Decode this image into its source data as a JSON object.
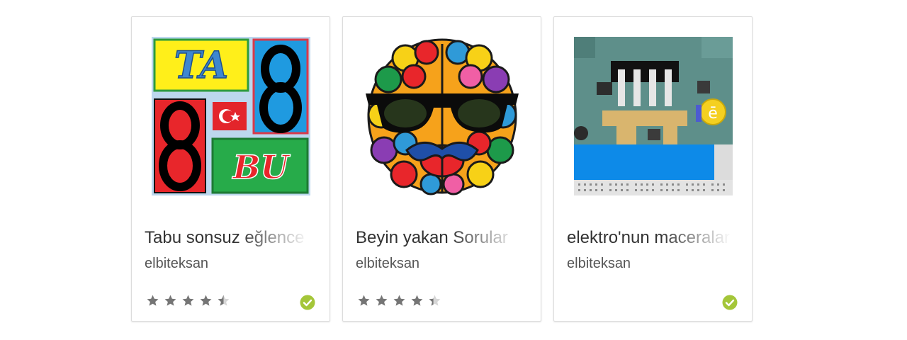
{
  "colors": {
    "star_filled": "#757575",
    "star_empty": "#d6d6d6",
    "badge": "#a4c639",
    "title": "#333333",
    "developer": "#555555"
  },
  "apps": [
    {
      "title": "Tabu sonsuz eğlence",
      "developer": "elbiteksan",
      "rating": 4.5,
      "thumbnail_icon": "tabu-app-icon",
      "badge_icon": "verified-check-icon"
    },
    {
      "title": "Beyin yakan Sorular",
      "developer": "elbiteksan",
      "rating": 4.4,
      "thumbnail_icon": "brain-sunglasses-app-icon",
      "badge_icon": null
    },
    {
      "title": "elektro'nun maceraları",
      "developer": "elbiteksan",
      "rating": null,
      "thumbnail_icon": "circuit-board-app-icon",
      "badge_icon": "verified-check-icon"
    }
  ]
}
